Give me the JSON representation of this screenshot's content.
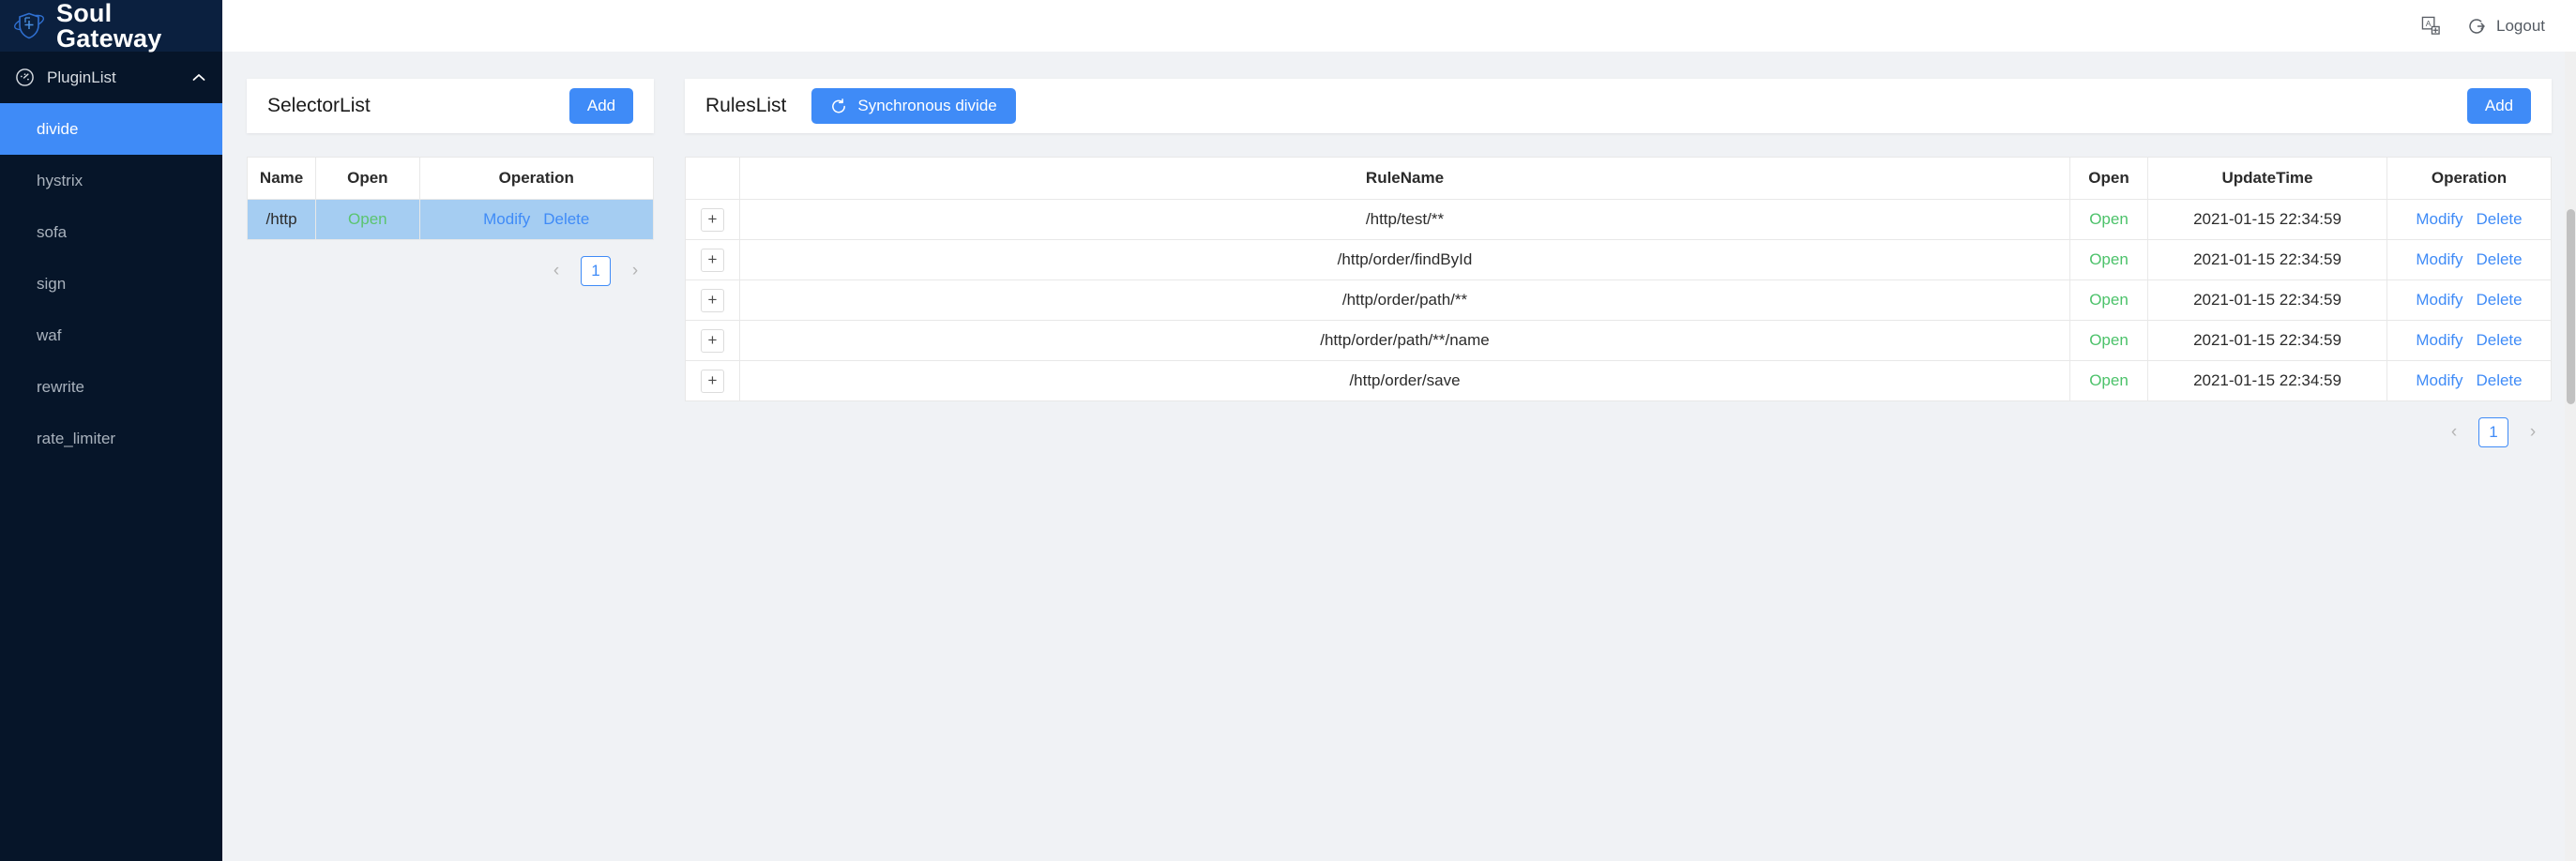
{
  "brand": {
    "title": "Soul Gateway",
    "logo_icon": "shield-plus-orbit-icon"
  },
  "sidebar": {
    "group": {
      "label": "PluginList",
      "icon": "dashboard-icon",
      "chevron": "chevron-up-icon"
    },
    "items": [
      {
        "label": "divide",
        "active": true
      },
      {
        "label": "hystrix",
        "active": false
      },
      {
        "label": "sofa",
        "active": false
      },
      {
        "label": "sign",
        "active": false
      },
      {
        "label": "waf",
        "active": false
      },
      {
        "label": "rewrite",
        "active": false
      },
      {
        "label": "rate_limiter",
        "active": false
      }
    ]
  },
  "topbar": {
    "language_icon": "translate-icon",
    "logout_icon": "logout-icon",
    "logout_label": "Logout"
  },
  "selector_panel": {
    "title": "SelectorList",
    "add_label": "Add",
    "columns": [
      "Name",
      "Open",
      "Operation"
    ],
    "rows": [
      {
        "name": "/http",
        "open": "Open",
        "modify": "Modify",
        "delete": "Delete",
        "selected": true
      }
    ],
    "pagination": {
      "prev": "‹",
      "page": "1",
      "next": "›"
    }
  },
  "rules_panel": {
    "title": "RulesList",
    "sync_label": "Synchronous divide",
    "sync_icon": "refresh-icon",
    "add_label": "Add",
    "columns": [
      "",
      "RuleName",
      "Open",
      "UpdateTime",
      "Operation"
    ],
    "expand_symbol": "+",
    "rows": [
      {
        "rule_name": "/http/test/**",
        "open": "Open",
        "update_time": "2021-01-15 22:34:59",
        "modify": "Modify",
        "delete": "Delete"
      },
      {
        "rule_name": "/http/order/findById",
        "open": "Open",
        "update_time": "2021-01-15 22:34:59",
        "modify": "Modify",
        "delete": "Delete"
      },
      {
        "rule_name": "/http/order/path/**",
        "open": "Open",
        "update_time": "2021-01-15 22:34:59",
        "modify": "Modify",
        "delete": "Delete"
      },
      {
        "rule_name": "/http/order/path/**/name",
        "open": "Open",
        "update_time": "2021-01-15 22:34:59",
        "modify": "Modify",
        "delete": "Delete"
      },
      {
        "rule_name": "/http/order/save",
        "open": "Open",
        "update_time": "2021-01-15 22:34:59",
        "modify": "Modify",
        "delete": "Delete"
      }
    ],
    "pagination": {
      "prev": "‹",
      "page": "1",
      "next": "›"
    }
  },
  "colors": {
    "accent": "#3f8bf7",
    "sidebar_bg": "#061529",
    "brand_bg": "#0b203f",
    "selected_row": "#a5cdf2",
    "open_green": "#4cc26a",
    "page_bg": "#f0f2f5"
  }
}
